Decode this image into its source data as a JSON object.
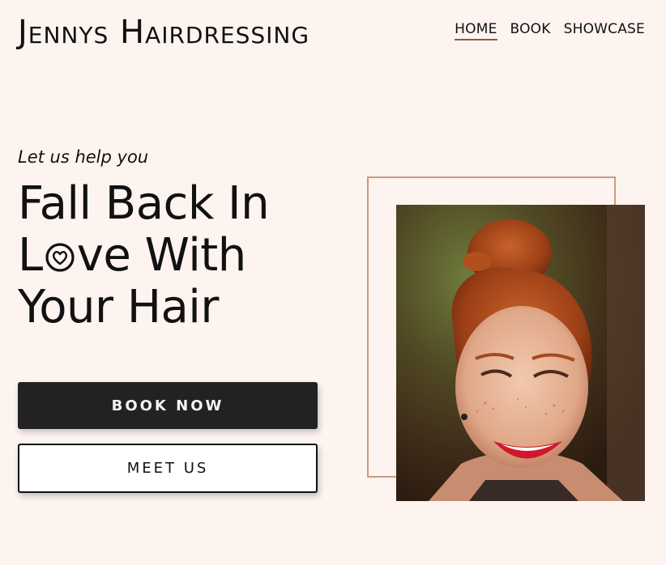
{
  "brand": {
    "title": "Jennys Hairdressing"
  },
  "nav": {
    "items": [
      {
        "label": "HOME",
        "active": true
      },
      {
        "label": "BOOK",
        "active": false
      },
      {
        "label": "SHOWCASE",
        "active": false
      }
    ]
  },
  "hero": {
    "tagline": "Let us help you",
    "headline_line1": "Fall Back In",
    "headline_line2_prefix": "L",
    "headline_line2_suffix": "ve With",
    "headline_line3": "Your Hair",
    "primary_button": "BOOK NOW",
    "secondary_button": "MEET US"
  },
  "colors": {
    "background": "#fdf4f0",
    "frame": "#c79c84",
    "primary_button": "#232222",
    "nav_underline": "#8b5a46"
  }
}
